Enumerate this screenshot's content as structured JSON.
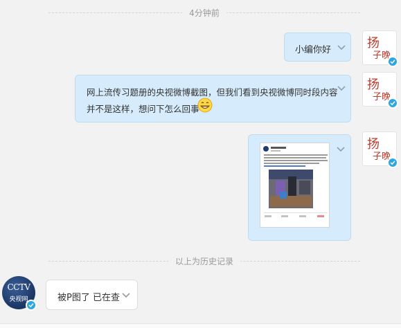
{
  "timestamp": "4分钟前",
  "history_divider": "以上为历史记录",
  "messages": [
    {
      "text": "小编你好"
    },
    {
      "text_line1": "网上流传习题册的央视微博截图，但我们看到央视微博同时段内容",
      "text_line2": "并不是这样，想问下怎么回事",
      "emoji": "grinning-face-emoji"
    },
    {
      "image": "weibo-screenshot-image"
    },
    {
      "text": "被P图了 已在查"
    }
  ],
  "avatars": {
    "right_glyph_top": "扬",
    "right_glyph_bottom": "子晚",
    "left_logo": "CCTV",
    "left_name": "央视网"
  },
  "colors": {
    "sent_bubble": "#d6ecfc",
    "received_bubble": "#ffffff",
    "verified_badge": "#2ea7e0",
    "avatar_red": "#c0392b"
  },
  "icons": [
    "chevron-down-icon",
    "verified-badge-icon"
  ]
}
